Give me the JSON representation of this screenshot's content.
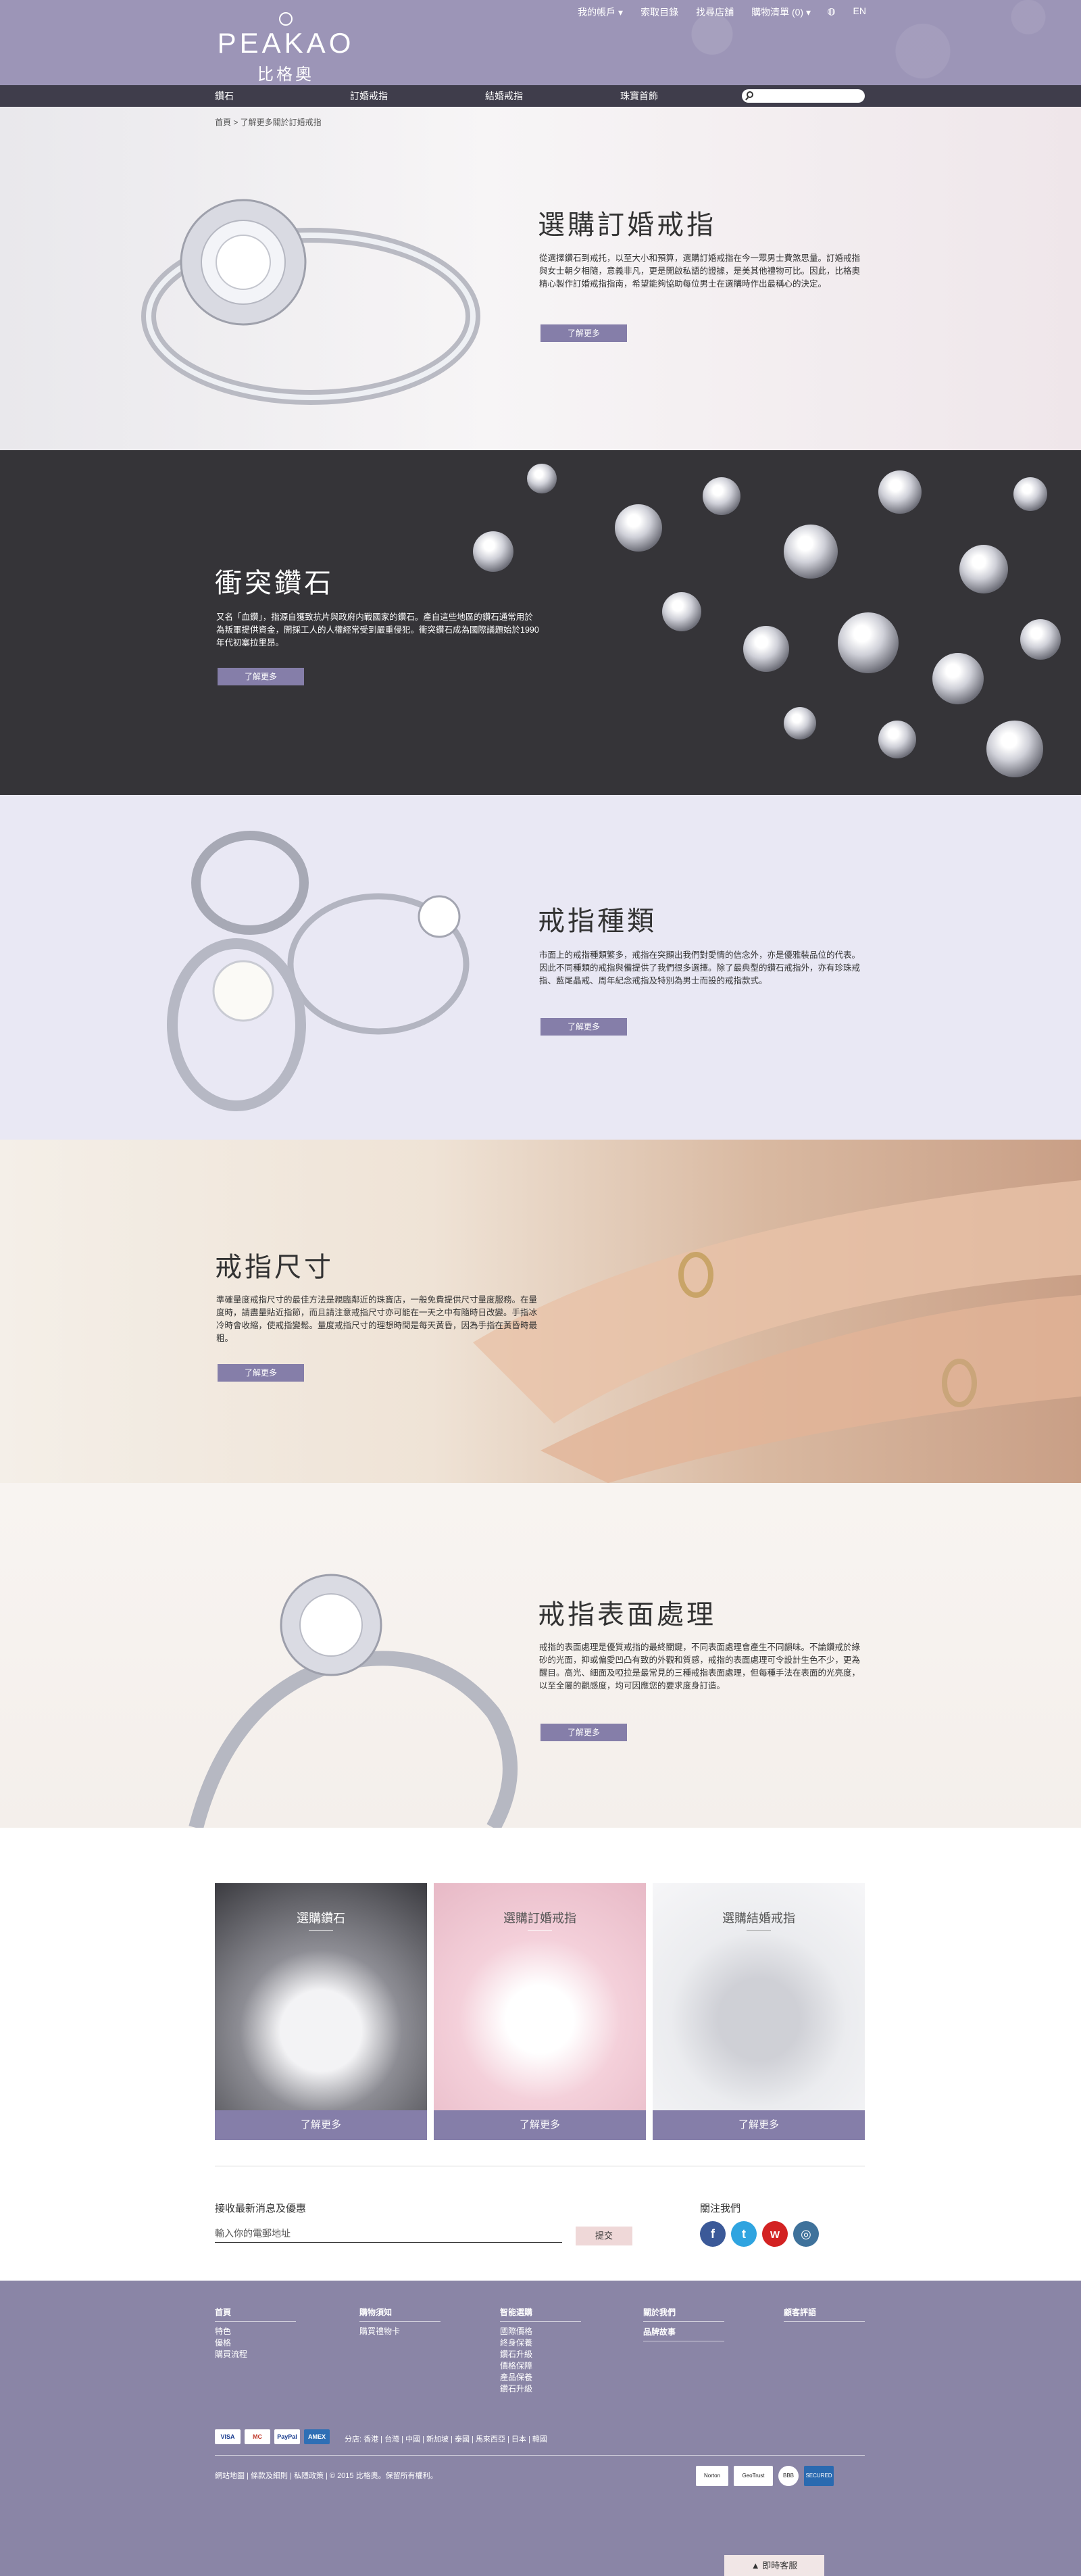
{
  "brand": {
    "name_en": "PEAKAO",
    "name_zh": "比格奧"
  },
  "toplinks": [
    "我的帳戶 ▾",
    "索取目錄",
    "找尋店舖",
    "購物清單 (0) ▾"
  ],
  "lang": "EN",
  "nav": [
    "鑽石",
    "訂婚戒指",
    "結婚戒指",
    "珠寶首飾"
  ],
  "search": {
    "placeholder": ""
  },
  "breadcrumb": "首頁  >  了解更多關於訂婚戒指",
  "sections": [
    {
      "title": "選購訂婚戒指",
      "text": "從選擇鑽石到戒托，以至大小和預算，選購訂婚戒指在今一眾男士費煞思量。訂婚戒指與女士朝夕相隨，意義非凡，更是開啟私語的證據，是美其他禮物可比。因此，比格奧精心製作訂婚戒指指南，希望能夠協助每位男士在選購時作出最稱心的決定。",
      "button": "了解更多"
    },
    {
      "title": "衝突鑽石",
      "text": "又名「血鑽」，指源自獲致抗片與政府内戰國家的鑽石。產自這些地區的鑽石通常用於為叛軍提供資金，開採工人的人權經常受到嚴重侵犯。衝突鑽石成為國際議題始於1990年代初塞拉里昂。",
      "button": "了解更多"
    },
    {
      "title": "戒指種類",
      "text": "市面上的戒指種類繁多，戒指在突顯出我們對愛情的信念外，亦是優雅裝品位的代表。因此不同種類的戒指與備提供了我們很多選擇。除了最典型的鑽石戒指外，亦有珍珠戒指、藍尾晶戒、周年紀念戒指及特別為男士而設的戒指款式。",
      "button": "了解更多"
    },
    {
      "title": "戒指尺寸",
      "text": "準確量度戒指尺寸的最佳方法是親臨鄰近的珠寶店，一般免費提供尺寸量度服務。在量度時，請盡量貼近指節，而且請注意戒指尺寸亦可能在一天之中有隨時日改變。手指冰冷時會收縮，使戒指變鬆。量度戒指尺寸的理想時間是每天黃昏，因為手指在黃昏時最粗。",
      "button": "了解更多"
    },
    {
      "title": "戒指表面處理",
      "text": "戒指的表面處理是優質戒指的最終關鍵，不同表面處理會產生不同韻味。不論鑽戒於綠砂的光面，抑或偏愛凹凸有致的外觀和質感，戒指的表面處理可令設計生色不少，更為醒目。高光、細面及啞拉是最常見的三種戒指表面處理，但每種手法在表面的光亮度，以至全屬的觀感度，均可因應您的要求度身訂造。",
      "button": "了解更多"
    }
  ],
  "cards": [
    {
      "title": "選購鑽石",
      "button": "了解更多"
    },
    {
      "title": "選購訂婚戒指",
      "button": "了解更多"
    },
    {
      "title": "選購結婚戒指",
      "button": "了解更多"
    }
  ],
  "newsletter": {
    "title": "接收最新消息及優惠",
    "placeholder": "輸入你的電郵地址",
    "button": "提交"
  },
  "follow": {
    "title": "關注我們",
    "icons": [
      "facebook-icon",
      "twitter-icon",
      "weibo-icon",
      "instagram-icon"
    ]
  },
  "footer": {
    "cols": [
      {
        "head": "首頁",
        "links": [
          "特色",
          "優格",
          "購買流程"
        ]
      },
      {
        "head": "購物須知",
        "links": [
          "購買禮物卡"
        ]
      },
      {
        "head": "智能選購",
        "links": [
          "國際價格",
          "終身保養",
          "鑽石升級",
          "價格保障",
          "產品保養",
          "鑽石升級"
        ]
      },
      {
        "head": "關於我們",
        "links": []
      },
      {
        "head": "顧客評語",
        "links": []
      }
    ],
    "brand_story": "品牌故事",
    "payments": [
      "VISA",
      "MC",
      "PayPal",
      "AMEX"
    ],
    "regions": "分店: 香港 | 台灣 | 中國 | 新加坡 | 泰國 | 馬來西亞 | 日本 | 韓國",
    "legal": "網站地圖 | 條款及細則 | 私隱政策 | © 2015 比格奧。保留所有權利。",
    "badges": [
      "Norton",
      "GeoTrust",
      "BBB",
      "SECURED"
    ]
  },
  "chat": "▲ 即時客服"
}
